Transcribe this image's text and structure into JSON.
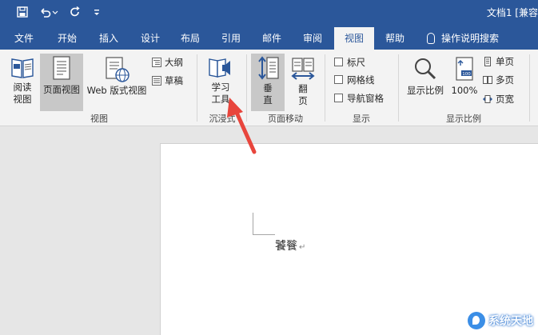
{
  "titlebar": {
    "doc_title": "文档1 [兼容",
    "qat": {
      "save_icon": "save-icon",
      "undo_icon": "undo-icon",
      "redo_icon": "redo-icon",
      "customize_icon": "customize-qat-icon"
    }
  },
  "tabs": [
    {
      "id": "file",
      "label": "文件"
    },
    {
      "id": "home",
      "label": "开始"
    },
    {
      "id": "insert",
      "label": "插入"
    },
    {
      "id": "design",
      "label": "设计"
    },
    {
      "id": "layout",
      "label": "布局"
    },
    {
      "id": "references",
      "label": "引用"
    },
    {
      "id": "mailings",
      "label": "邮件"
    },
    {
      "id": "review",
      "label": "审阅"
    },
    {
      "id": "view",
      "label": "视图",
      "active": true
    },
    {
      "id": "help",
      "label": "帮助"
    }
  ],
  "tell_me": {
    "label": "操作说明搜索",
    "icon": "lightbulb-icon"
  },
  "ribbon": {
    "views": {
      "label": "视图",
      "read_mode": "阅读\n视图",
      "read_mode_l1": "阅读",
      "read_mode_l2": "视图",
      "print_layout": "页面视图",
      "web_layout": "Web 版式视图",
      "outline": "大纲",
      "draft": "草稿"
    },
    "immersive": {
      "label": "沉浸式",
      "learning_tools_l1": "学习",
      "learning_tools_l2": "工具"
    },
    "page_movement": {
      "label": "页面移动",
      "vertical_l1": "垂",
      "vertical_l2": "直",
      "side_to_side_l1": "翻",
      "side_to_side_l2": "页"
    },
    "show": {
      "label": "显示",
      "ruler": "标尺",
      "gridlines": "网格线",
      "nav_pane": "导航窗格"
    },
    "zoom": {
      "label": "显示比例",
      "zoom": "显示比例",
      "hundred": "100%",
      "one_page": "单页",
      "multiple_pages": "多页",
      "page_width": "页宽"
    }
  },
  "document": {
    "text": "饕餮",
    "para_mark": "↵"
  },
  "watermark": {
    "text": "系统天地"
  },
  "colors": {
    "accent": "#2b579a",
    "ribbon_bg": "#f3f3f3",
    "doc_bg": "#e6e6e6",
    "arrow": "#e8453c"
  }
}
